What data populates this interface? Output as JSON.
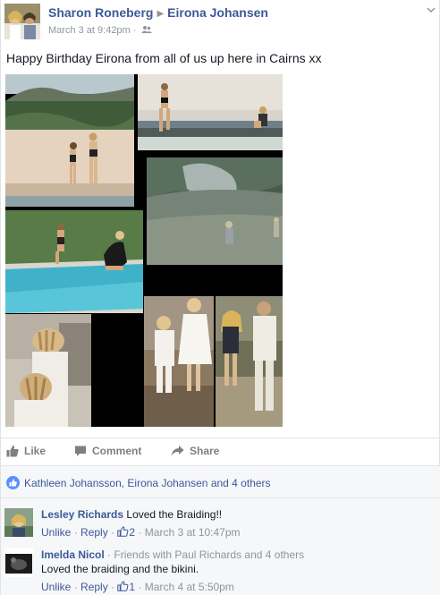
{
  "post": {
    "author": "Sharon Roneberg",
    "target": "Eirona Johansen",
    "timestamp": "March 3 at 9:42pm",
    "audience_icon": "friends-icon",
    "message": "Happy Birthday Eirona from all of us up here in Cairns xx"
  },
  "actions": {
    "like": "Like",
    "comment": "Comment",
    "share": "Share"
  },
  "likes": {
    "text": "Kathleen Johansson, Eirona Johansen and 4 others"
  },
  "comments": [
    {
      "author": "Lesley Richards",
      "text": "Loved the Braiding!!",
      "unlike": "Unlike",
      "reply": "Reply",
      "like_count": "2",
      "time": "March 3 at 10:47pm"
    },
    {
      "author": "Imelda Nicol",
      "context": "Friends with Paul Richards and 4 others",
      "text": "Loved the braiding and the bikini.",
      "unlike": "Unlike",
      "reply": "Reply",
      "like_count": "1",
      "time": "March 4 at 5:50pm"
    }
  ],
  "colors": {
    "link": "#3b5998",
    "meta": "#90949c",
    "like_blue": "#5890ff"
  }
}
